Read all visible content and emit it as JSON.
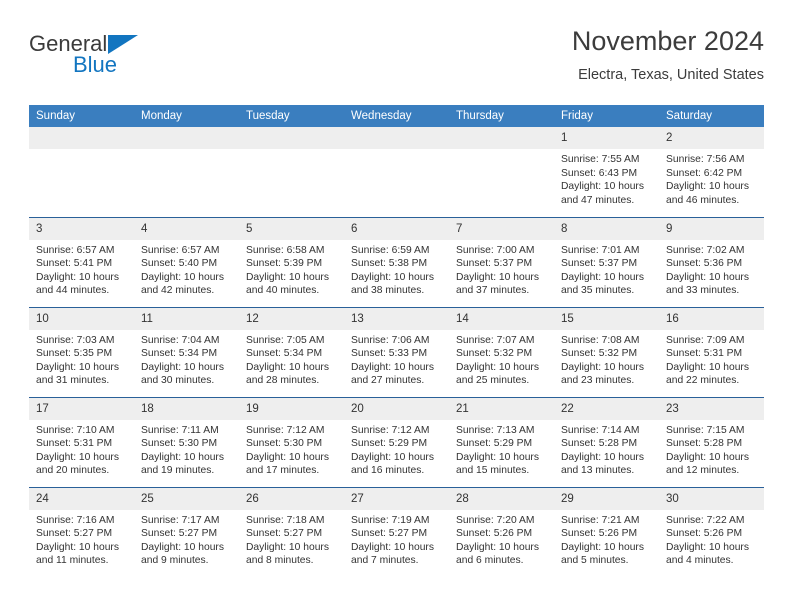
{
  "brand": {
    "name_part1": "General",
    "name_part2": "Blue",
    "triangle_color": "#1275c0"
  },
  "header": {
    "title": "November 2024",
    "subtitle": "Electra, Texas, United States"
  },
  "colors": {
    "header_blue": "#3a7ebf",
    "row_divider": "#2a6099",
    "daynum_band": "#eeeeee",
    "text": "#333333"
  },
  "weekday_headers": [
    "Sunday",
    "Monday",
    "Tuesday",
    "Wednesday",
    "Thursday",
    "Friday",
    "Saturday"
  ],
  "weeks": [
    [
      {
        "day": "",
        "sunrise": "",
        "sunset": "",
        "daylight": ""
      },
      {
        "day": "",
        "sunrise": "",
        "sunset": "",
        "daylight": ""
      },
      {
        "day": "",
        "sunrise": "",
        "sunset": "",
        "daylight": ""
      },
      {
        "day": "",
        "sunrise": "",
        "sunset": "",
        "daylight": ""
      },
      {
        "day": "",
        "sunrise": "",
        "sunset": "",
        "daylight": ""
      },
      {
        "day": "1",
        "sunrise": "Sunrise: 7:55 AM",
        "sunset": "Sunset: 6:43 PM",
        "daylight": "Daylight: 10 hours and 47 minutes."
      },
      {
        "day": "2",
        "sunrise": "Sunrise: 7:56 AM",
        "sunset": "Sunset: 6:42 PM",
        "daylight": "Daylight: 10 hours and 46 minutes."
      }
    ],
    [
      {
        "day": "3",
        "sunrise": "Sunrise: 6:57 AM",
        "sunset": "Sunset: 5:41 PM",
        "daylight": "Daylight: 10 hours and 44 minutes."
      },
      {
        "day": "4",
        "sunrise": "Sunrise: 6:57 AM",
        "sunset": "Sunset: 5:40 PM",
        "daylight": "Daylight: 10 hours and 42 minutes."
      },
      {
        "day": "5",
        "sunrise": "Sunrise: 6:58 AM",
        "sunset": "Sunset: 5:39 PM",
        "daylight": "Daylight: 10 hours and 40 minutes."
      },
      {
        "day": "6",
        "sunrise": "Sunrise: 6:59 AM",
        "sunset": "Sunset: 5:38 PM",
        "daylight": "Daylight: 10 hours and 38 minutes."
      },
      {
        "day": "7",
        "sunrise": "Sunrise: 7:00 AM",
        "sunset": "Sunset: 5:37 PM",
        "daylight": "Daylight: 10 hours and 37 minutes."
      },
      {
        "day": "8",
        "sunrise": "Sunrise: 7:01 AM",
        "sunset": "Sunset: 5:37 PM",
        "daylight": "Daylight: 10 hours and 35 minutes."
      },
      {
        "day": "9",
        "sunrise": "Sunrise: 7:02 AM",
        "sunset": "Sunset: 5:36 PM",
        "daylight": "Daylight: 10 hours and 33 minutes."
      }
    ],
    [
      {
        "day": "10",
        "sunrise": "Sunrise: 7:03 AM",
        "sunset": "Sunset: 5:35 PM",
        "daylight": "Daylight: 10 hours and 31 minutes."
      },
      {
        "day": "11",
        "sunrise": "Sunrise: 7:04 AM",
        "sunset": "Sunset: 5:34 PM",
        "daylight": "Daylight: 10 hours and 30 minutes."
      },
      {
        "day": "12",
        "sunrise": "Sunrise: 7:05 AM",
        "sunset": "Sunset: 5:34 PM",
        "daylight": "Daylight: 10 hours and 28 minutes."
      },
      {
        "day": "13",
        "sunrise": "Sunrise: 7:06 AM",
        "sunset": "Sunset: 5:33 PM",
        "daylight": "Daylight: 10 hours and 27 minutes."
      },
      {
        "day": "14",
        "sunrise": "Sunrise: 7:07 AM",
        "sunset": "Sunset: 5:32 PM",
        "daylight": "Daylight: 10 hours and 25 minutes."
      },
      {
        "day": "15",
        "sunrise": "Sunrise: 7:08 AM",
        "sunset": "Sunset: 5:32 PM",
        "daylight": "Daylight: 10 hours and 23 minutes."
      },
      {
        "day": "16",
        "sunrise": "Sunrise: 7:09 AM",
        "sunset": "Sunset: 5:31 PM",
        "daylight": "Daylight: 10 hours and 22 minutes."
      }
    ],
    [
      {
        "day": "17",
        "sunrise": "Sunrise: 7:10 AM",
        "sunset": "Sunset: 5:31 PM",
        "daylight": "Daylight: 10 hours and 20 minutes."
      },
      {
        "day": "18",
        "sunrise": "Sunrise: 7:11 AM",
        "sunset": "Sunset: 5:30 PM",
        "daylight": "Daylight: 10 hours and 19 minutes."
      },
      {
        "day": "19",
        "sunrise": "Sunrise: 7:12 AM",
        "sunset": "Sunset: 5:30 PM",
        "daylight": "Daylight: 10 hours and 17 minutes."
      },
      {
        "day": "20",
        "sunrise": "Sunrise: 7:12 AM",
        "sunset": "Sunset: 5:29 PM",
        "daylight": "Daylight: 10 hours and 16 minutes."
      },
      {
        "day": "21",
        "sunrise": "Sunrise: 7:13 AM",
        "sunset": "Sunset: 5:29 PM",
        "daylight": "Daylight: 10 hours and 15 minutes."
      },
      {
        "day": "22",
        "sunrise": "Sunrise: 7:14 AM",
        "sunset": "Sunset: 5:28 PM",
        "daylight": "Daylight: 10 hours and 13 minutes."
      },
      {
        "day": "23",
        "sunrise": "Sunrise: 7:15 AM",
        "sunset": "Sunset: 5:28 PM",
        "daylight": "Daylight: 10 hours and 12 minutes."
      }
    ],
    [
      {
        "day": "24",
        "sunrise": "Sunrise: 7:16 AM",
        "sunset": "Sunset: 5:27 PM",
        "daylight": "Daylight: 10 hours and 11 minutes."
      },
      {
        "day": "25",
        "sunrise": "Sunrise: 7:17 AM",
        "sunset": "Sunset: 5:27 PM",
        "daylight": "Daylight: 10 hours and 9 minutes."
      },
      {
        "day": "26",
        "sunrise": "Sunrise: 7:18 AM",
        "sunset": "Sunset: 5:27 PM",
        "daylight": "Daylight: 10 hours and 8 minutes."
      },
      {
        "day": "27",
        "sunrise": "Sunrise: 7:19 AM",
        "sunset": "Sunset: 5:27 PM",
        "daylight": "Daylight: 10 hours and 7 minutes."
      },
      {
        "day": "28",
        "sunrise": "Sunrise: 7:20 AM",
        "sunset": "Sunset: 5:26 PM",
        "daylight": "Daylight: 10 hours and 6 minutes."
      },
      {
        "day": "29",
        "sunrise": "Sunrise: 7:21 AM",
        "sunset": "Sunset: 5:26 PM",
        "daylight": "Daylight: 10 hours and 5 minutes."
      },
      {
        "day": "30",
        "sunrise": "Sunrise: 7:22 AM",
        "sunset": "Sunset: 5:26 PM",
        "daylight": "Daylight: 10 hours and 4 minutes."
      }
    ]
  ]
}
